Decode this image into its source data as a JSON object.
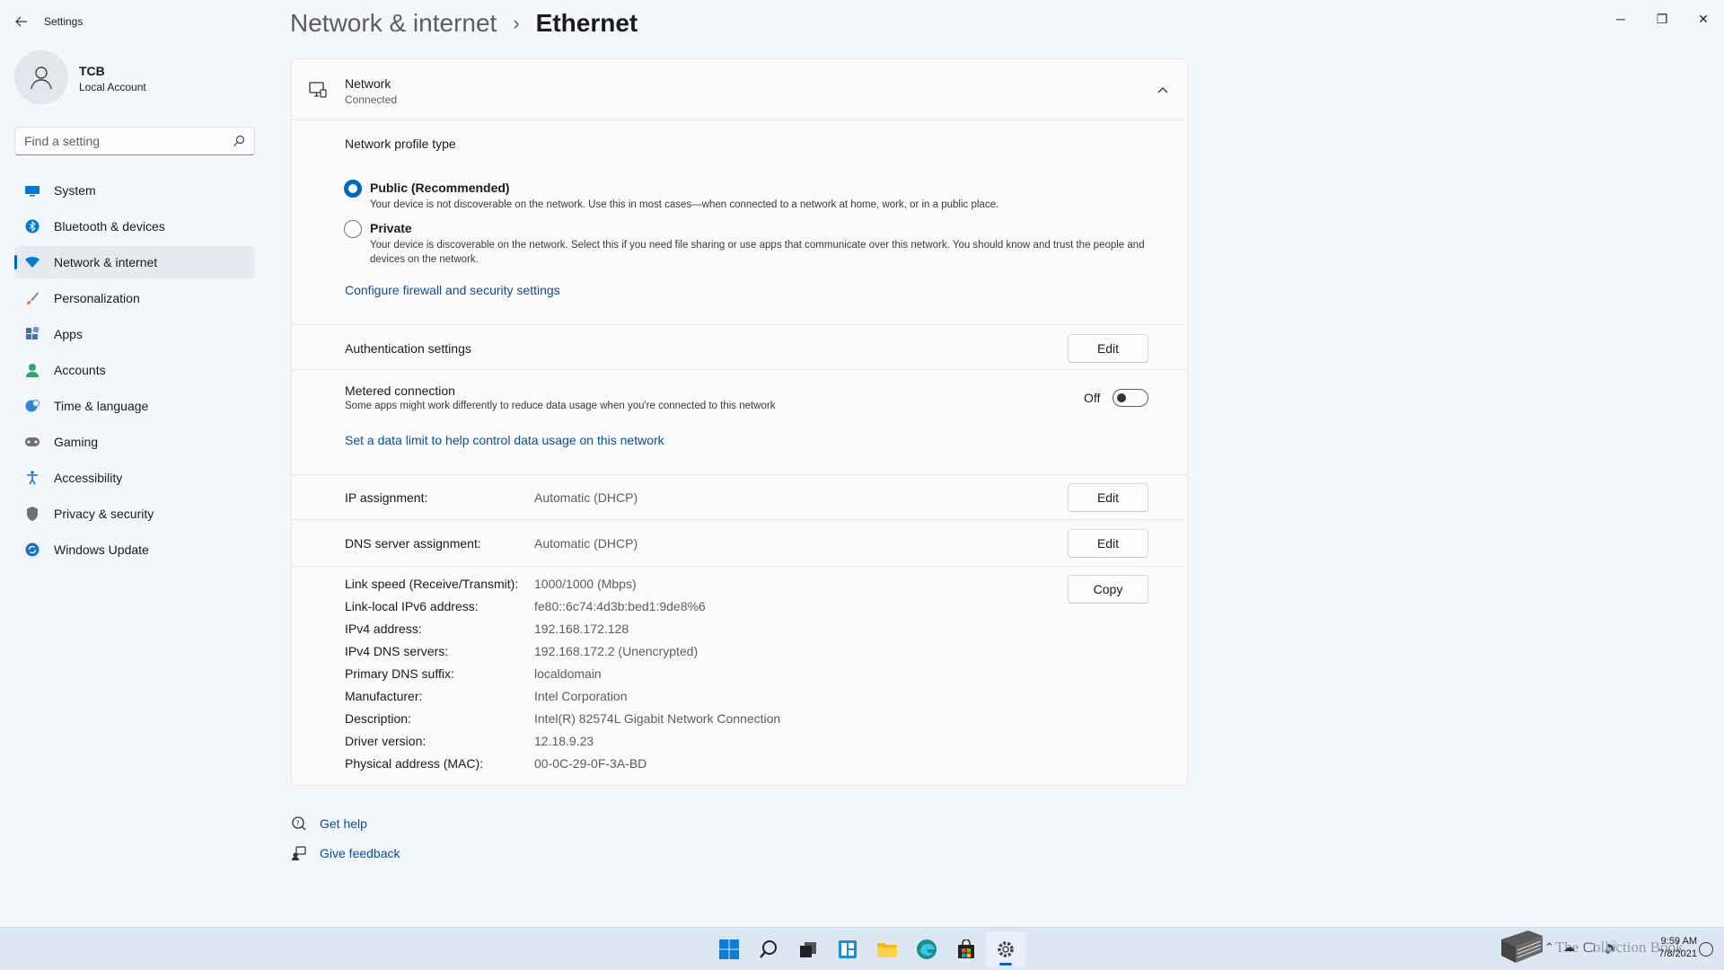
{
  "window": {
    "app_title": "Settings",
    "controls": {
      "minimize": "─",
      "maximize": "❐",
      "close": "✕"
    }
  },
  "profile": {
    "name": "TCB",
    "account_type": "Local Account"
  },
  "search": {
    "placeholder": "Find a setting"
  },
  "sidebar": {
    "items": [
      {
        "label": "System",
        "icon": "monitor-icon",
        "color": "#0078d4"
      },
      {
        "label": "Bluetooth & devices",
        "icon": "bluetooth-icon",
        "color": "#0078d4"
      },
      {
        "label": "Network & internet",
        "icon": "wifi-icon",
        "color": "#0078d4",
        "active": true
      },
      {
        "label": "Personalization",
        "icon": "brush-icon",
        "color": "#d17a3b"
      },
      {
        "label": "Apps",
        "icon": "apps-icon",
        "color": "#4a6fa5"
      },
      {
        "label": "Accounts",
        "icon": "person-icon",
        "color": "#2ea56b"
      },
      {
        "label": "Time & language",
        "icon": "globe-clock-icon",
        "color": "#2a8ad4"
      },
      {
        "label": "Gaming",
        "icon": "gamepad-icon",
        "color": "#707070"
      },
      {
        "label": "Accessibility",
        "icon": "accessibility-icon",
        "color": "#1a73c7"
      },
      {
        "label": "Privacy & security",
        "icon": "shield-icon",
        "color": "#707070"
      },
      {
        "label": "Windows Update",
        "icon": "update-icon",
        "color": "#1a73c7"
      }
    ]
  },
  "header": {
    "parent": "Network & internet",
    "separator": "›",
    "current": "Ethernet"
  },
  "network": {
    "title": "Network",
    "status": "Connected",
    "profile_type_label": "Network profile type",
    "options": [
      {
        "title": "Public (Recommended)",
        "desc": "Your device is not discoverable on the network. Use this in most cases—when connected to a network at home, work, or in a public place.",
        "checked": true
      },
      {
        "title": "Private",
        "desc": "Your device is discoverable on the network. Select this if you need file sharing or use apps that communicate over this network. You should know and trust the people and devices on the network.",
        "checked": false
      }
    ],
    "firewall_link": "Configure firewall and security settings",
    "auth_label": "Authentication settings",
    "edit_label": "Edit",
    "metered_label": "Metered connection",
    "metered_desc": "Some apps might work differently to reduce data usage when you're connected to this network",
    "metered_state": "Off",
    "data_limit_link": "Set a data limit to help control data usage on this network",
    "ip_label": "IP assignment:",
    "ip_value": "Automatic (DHCP)",
    "dns_label": "DNS server assignment:",
    "dns_value": "Automatic (DHCP)",
    "copy_label": "Copy",
    "properties": [
      {
        "label": "Link speed (Receive/Transmit):",
        "value": "1000/1000 (Mbps)"
      },
      {
        "label": "Link-local IPv6 address:",
        "value": "fe80::6c74:4d3b:bed1:9de8%6"
      },
      {
        "label": "IPv4 address:",
        "value": "192.168.172.128"
      },
      {
        "label": "IPv4 DNS servers:",
        "value": "192.168.172.2 (Unencrypted)"
      },
      {
        "label": "Primary DNS suffix:",
        "value": "localdomain"
      },
      {
        "label": "Manufacturer:",
        "value": "Intel Corporation"
      },
      {
        "label": "Description:",
        "value": "Intel(R) 82574L Gigabit Network Connection"
      },
      {
        "label": "Driver version:",
        "value": "12.18.9.23"
      },
      {
        "label": "Physical address (MAC):",
        "value": "00-0C-29-0F-3A-BD"
      }
    ]
  },
  "help": {
    "get_help": "Get help",
    "give_feedback": "Give feedback"
  },
  "taskbar": {
    "icons": [
      "windows-start-icon",
      "search-icon",
      "task-view-icon",
      "widgets-icon",
      "file-explorer-icon",
      "edge-icon",
      "store-icon",
      "settings-icon"
    ],
    "time": "9:59 AM",
    "date": "7/8/2021",
    "watermark": "The Collection Book",
    "accent": "#0067c0"
  }
}
